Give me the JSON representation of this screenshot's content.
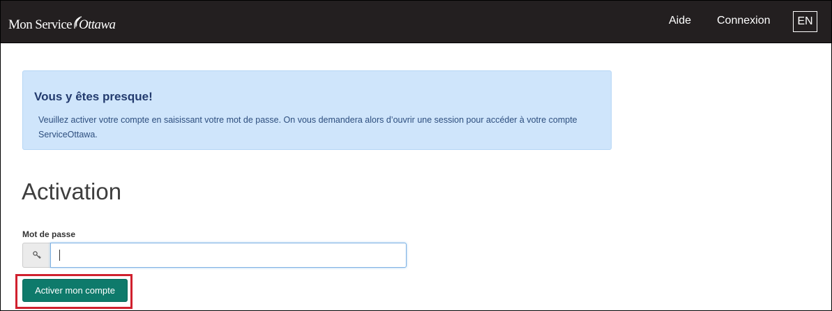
{
  "header": {
    "brand": {
      "part1": "Mon Service",
      "part2": "Ottawa"
    },
    "nav": {
      "help": "Aide",
      "login": "Connexion",
      "language": "EN"
    }
  },
  "alert": {
    "title": "Vous y êtes presque!",
    "text": "Veuillez activer votre compte en saisissant votre mot de passe. On vous demandera alors d’ouvrir une session pour accéder à votre compte ServiceOttawa."
  },
  "main": {
    "title": "Activation",
    "password": {
      "label": "Mot de passe",
      "value": "",
      "placeholder": "",
      "addon_icon": "key-icon"
    },
    "submit_label": "Activer mon compte"
  },
  "colors": {
    "navbar": "#231f20",
    "alert_background": "#cfe5fb",
    "primary_button": "#0e7a6b",
    "highlight": "#d0202e"
  }
}
